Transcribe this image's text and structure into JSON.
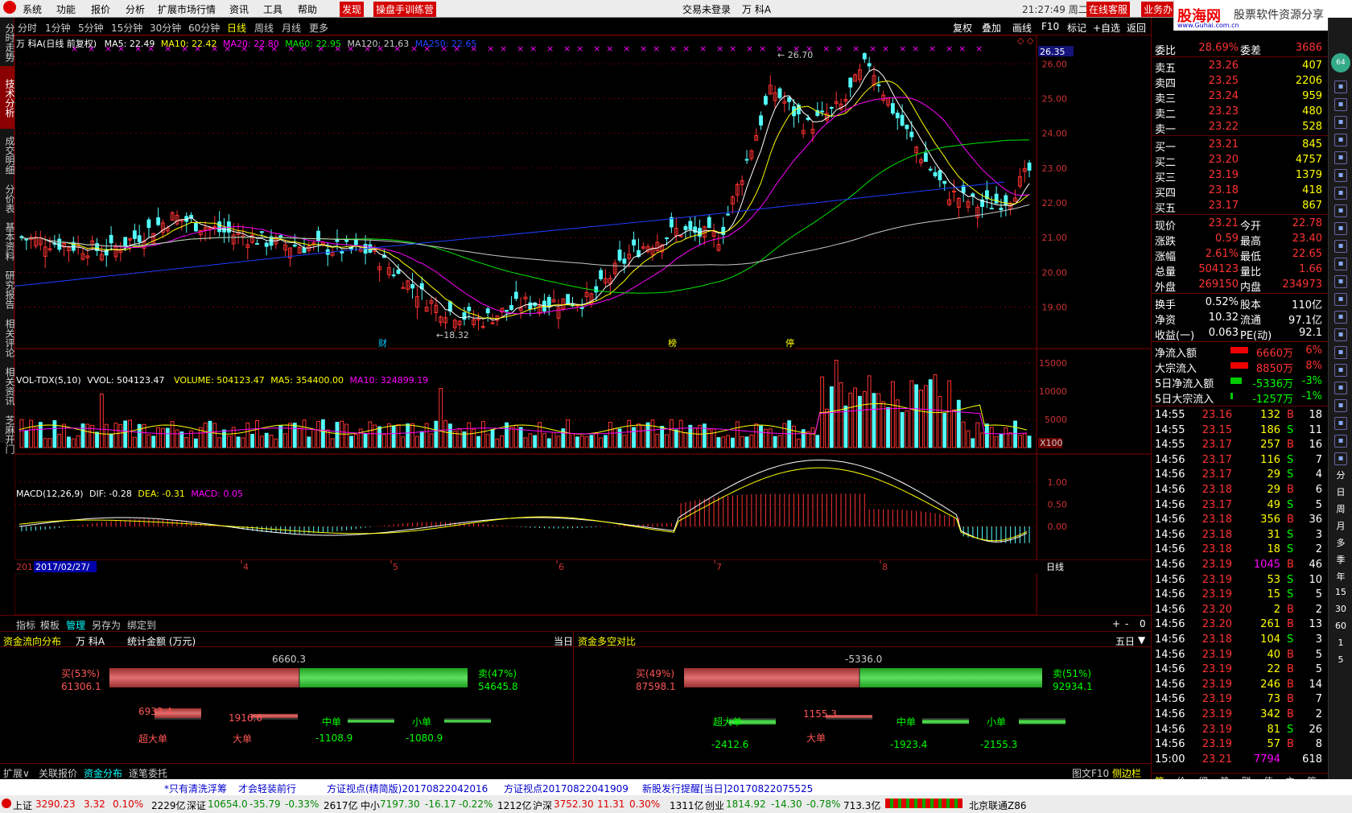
{
  "menubar": {
    "items": [
      "系统",
      "功能",
      "报价",
      "分析",
      "扩展市场行情",
      "资讯",
      "工具",
      "帮助"
    ],
    "find": "发现",
    "training": "操盘手训练营",
    "login_status": "交易未登录",
    "stock_name": "万 科A",
    "time": "21:27:49 周二",
    "online_service": "在线客服",
    "business": "业务办"
  },
  "ad": {
    "logo": "股海网",
    "tagline": "股票软件资源分享",
    "url": "www.Guhai.com.cn"
  },
  "left_tabs": [
    "分时走势",
    "技术分析",
    "成交明细",
    "分价表",
    "基本资料",
    "研究报告",
    "相关评论",
    "相关资讯",
    "芝麻开门"
  ],
  "period_tabs": [
    "分时",
    "1分钟",
    "5分钟",
    "15分钟",
    "30分钟",
    "60分钟",
    "日线",
    "周线",
    "月线",
    "更多"
  ],
  "active_period": "日线",
  "toolbar_right": [
    "复权",
    "叠加",
    "画线",
    "F10",
    "标记",
    "+自选",
    "返回"
  ],
  "main_legend": {
    "name": "万 科A(日线 前复权)",
    "ma5": "MA5: 22.49",
    "ma10": "MA10: 22.42",
    "ma20": "MA20: 22.80",
    "ma60": "MA60: 22.95",
    "ma120": "MA120: 21.63",
    "ma250": "MA250: 22.65"
  },
  "price_axis": [
    "26.00",
    "25.00",
    "24.00",
    "23.00",
    "22.00",
    "21.00",
    "20.00",
    "19.00"
  ],
  "price_tag": "26.35",
  "high_label": "26.70",
  "low_label": "18.32",
  "event_labels": [
    "财",
    "榜",
    "停"
  ],
  "vol_legend": {
    "name": "VOL-TDX(5,10)",
    "vvol": "VVOL: 504123.47",
    "volume": "VOLUME: 504123.47",
    "ma5": "MA5: 354400.00",
    "ma10": "MA10: 324899.19"
  },
  "vol_axis": [
    "15000",
    "10000",
    "5000"
  ],
  "vol_unit": "X100",
  "macd_legend": {
    "name": "MACD(12,26,9)",
    "dif": "DIF: -0.28",
    "dea": "DEA: -0.31",
    "macd": "MACD: 0.05"
  },
  "macd_axis": [
    "1.00",
    "0.50",
    "0.00"
  ],
  "date_axis": {
    "first": "201",
    "cursor_date": "2017/02/27/",
    "months": [
      "4",
      "5",
      "6",
      "7",
      "8"
    ],
    "period": "日线"
  },
  "bottom_tabs": [
    "指标",
    "模板",
    "管理",
    "另存为",
    "绑定到"
  ],
  "fund_flow": {
    "title": "资金流向分布",
    "stock": "万 科A",
    "unit": "统计金额 (万元)",
    "period": "当日",
    "net": "6660.3",
    "buy_label": "买(53%)",
    "buy_val": "61306.1",
    "sell_label": "卖(47%)",
    "sell_val": "54645.8",
    "cats": [
      {
        "name": "超大单",
        "val": "6933.4"
      },
      {
        "name": "大单",
        "val": "1916.6"
      },
      {
        "name": "中单",
        "val": "-1108.9"
      },
      {
        "name": "小单",
        "val": "-1080.9"
      }
    ]
  },
  "fund_compare": {
    "title": "资金多空对比",
    "period": "五日",
    "net": "-5336.0",
    "buy_label": "买(49%)",
    "buy_val": "87598.1",
    "sell_label": "卖(51%)",
    "sell_val": "92934.1",
    "cats": [
      {
        "name": "超大单",
        "val": "-2412.6"
      },
      {
        "name": "大单",
        "val": "1155.3"
      },
      {
        "name": "中单",
        "val": "-1923.4"
      },
      {
        "name": "小单",
        "val": "-2155.3"
      }
    ]
  },
  "block_tabs": [
    "扩展∨",
    "关联报价",
    "资金分布",
    "逐笔委托"
  ],
  "block_right": [
    "图文F10",
    "侧边栏<<"
  ],
  "quote": {
    "header": [
      "委比",
      "28.69%",
      "委差",
      "3686"
    ],
    "sells": [
      [
        "卖五",
        "23.26",
        "407"
      ],
      [
        "卖四",
        "23.25",
        "2206"
      ],
      [
        "卖三",
        "23.24",
        "959"
      ],
      [
        "卖二",
        "23.23",
        "480"
      ],
      [
        "卖一",
        "23.22",
        "528"
      ]
    ],
    "buys": [
      [
        "买一",
        "23.21",
        "845"
      ],
      [
        "买二",
        "23.20",
        "4757"
      ],
      [
        "买三",
        "23.19",
        "1379"
      ],
      [
        "买四",
        "23.18",
        "418"
      ],
      [
        "买五",
        "23.17",
        "867"
      ]
    ],
    "stats": [
      [
        "现价",
        "23.21",
        "今开",
        "22.78"
      ],
      [
        "涨跌",
        "0.59",
        "最高",
        "23.40"
      ],
      [
        "涨幅",
        "2.61%",
        "最低",
        "22.65"
      ],
      [
        "总量",
        "504123",
        "量比",
        "1.66"
      ],
      [
        "外盘",
        "269150",
        "内盘",
        "234973"
      ]
    ],
    "stats2": [
      [
        "换手",
        "0.52%",
        "股本",
        "110亿"
      ],
      [
        "净资",
        "10.32",
        "流通",
        "97.1亿"
      ],
      [
        "收益(一)",
        "0.063",
        "PE(动)",
        "92.1"
      ]
    ],
    "flows": [
      [
        "净流入额",
        "6660万",
        "6%"
      ],
      [
        "大宗流入",
        "8850万",
        "8%"
      ],
      [
        "5日净流入额",
        "-5336万",
        "-3%"
      ],
      [
        "5日大宗流入",
        "-1257万",
        "-1%"
      ]
    ],
    "ticks": [
      [
        "14:55",
        "23.16",
        "132",
        "B",
        "18"
      ],
      [
        "14:55",
        "23.15",
        "186",
        "S",
        "11"
      ],
      [
        "14:55",
        "23.17",
        "257",
        "B",
        "16"
      ],
      [
        "14:56",
        "23.17",
        "116",
        "S",
        "7"
      ],
      [
        "14:56",
        "23.17",
        "29",
        "S",
        "4"
      ],
      [
        "14:56",
        "23.18",
        "29",
        "B",
        "6"
      ],
      [
        "14:56",
        "23.17",
        "49",
        "S",
        "5"
      ],
      [
        "14:56",
        "23.18",
        "356",
        "B",
        "36"
      ],
      [
        "14:56",
        "23.18",
        "31",
        "S",
        "3"
      ],
      [
        "14:56",
        "23.18",
        "18",
        "S",
        "2"
      ],
      [
        "14:56",
        "23.19",
        "1045",
        "B",
        "46"
      ],
      [
        "14:56",
        "23.19",
        "53",
        "S",
        "10"
      ],
      [
        "14:56",
        "23.19",
        "15",
        "S",
        "5"
      ],
      [
        "14:56",
        "23.20",
        "2",
        "B",
        "2"
      ],
      [
        "14:56",
        "23.20",
        "261",
        "B",
        "13"
      ],
      [
        "14:56",
        "23.18",
        "104",
        "S",
        "3"
      ],
      [
        "14:56",
        "23.19",
        "40",
        "B",
        "5"
      ],
      [
        "14:56",
        "23.19",
        "22",
        "B",
        "5"
      ],
      [
        "14:56",
        "23.19",
        "246",
        "B",
        "14"
      ],
      [
        "14:56",
        "23.19",
        "73",
        "B",
        "7"
      ],
      [
        "14:56",
        "23.19",
        "342",
        "B",
        "2"
      ],
      [
        "14:56",
        "23.19",
        "81",
        "S",
        "26"
      ],
      [
        "14:56",
        "23.19",
        "57",
        "B",
        "8"
      ],
      [
        "15:00",
        "23.21",
        "7794",
        "",
        "618"
      ]
    ],
    "bottom_tabs": [
      "笔",
      "价",
      "细",
      "势",
      "联",
      "值",
      "主",
      "筹"
    ]
  },
  "side_icons": [
    "64",
    "分",
    "日",
    "周",
    "月",
    "多",
    "季",
    "年",
    "15",
    "30",
    "60",
    "1",
    "5"
  ],
  "news": [
    "*只有清洗浮筹",
    "才会轻装前行",
    "方证视点(精简版)20170822042016",
    "方证视点20170822041909",
    "新股发行提醒[当日]20170822075525"
  ],
  "status": {
    "sh": "上证",
    "sh_val": "3290.23",
    "sh_chg": "3.32",
    "sh_pct": "0.10%",
    "sh_amt": "2229亿",
    "sz": "深证",
    "sz_val": "10654.0",
    "sz_chg": "-35.79",
    "sz_pct": "-0.33%",
    "sz_amt": "2617亿",
    "zx": "中小",
    "zx_val": "7197.30",
    "zx_chg": "-16.17",
    "zx_pct": "-0.22%",
    "zx_amt": "1212亿",
    "hs": "沪深",
    "hs_val": "3752.30",
    "hs_chg": "11.31",
    "hs_pct": "0.30%",
    "hs_amt": "1311亿",
    "cy": "创业",
    "cy_val": "1814.92",
    "cy_chg": "-14.30",
    "cy_pct": "-0.78%",
    "cy_amt": "713.3亿",
    "server": "北京联通Z86"
  },
  "colors": {
    "up": "#ff3232",
    "down": "#54fcfc",
    "ma5": "#ffffff",
    "ma10": "#ffff00",
    "ma20": "#ff00ff",
    "ma60": "#00e600",
    "ma120": "#c8c8c8",
    "ma250": "#1e3cff"
  }
}
